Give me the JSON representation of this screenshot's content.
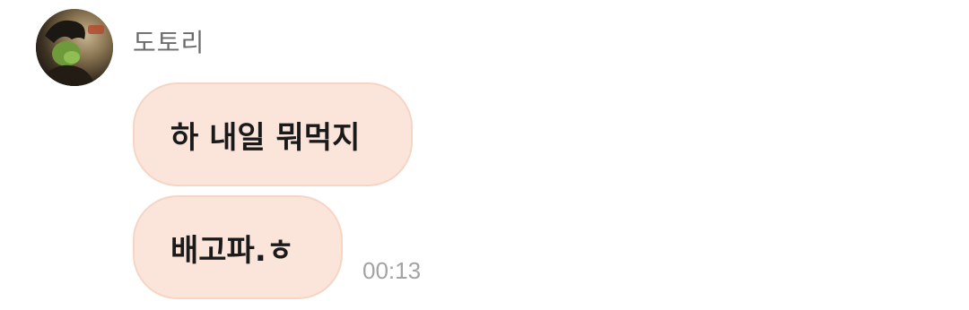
{
  "chat": {
    "sender": {
      "name": "도토리",
      "avatar_icon": "profile-photo"
    },
    "messages": [
      {
        "text": "하 내일 뭐먹지"
      },
      {
        "text": "배고파.ㅎ"
      }
    ],
    "last_message_time": "00:13"
  },
  "colors": {
    "bubble_background": "#fbe5da",
    "bubble_border": "#f5d5c4",
    "sender_name": "#6b6b6b",
    "timestamp": "#a3a3a3"
  }
}
